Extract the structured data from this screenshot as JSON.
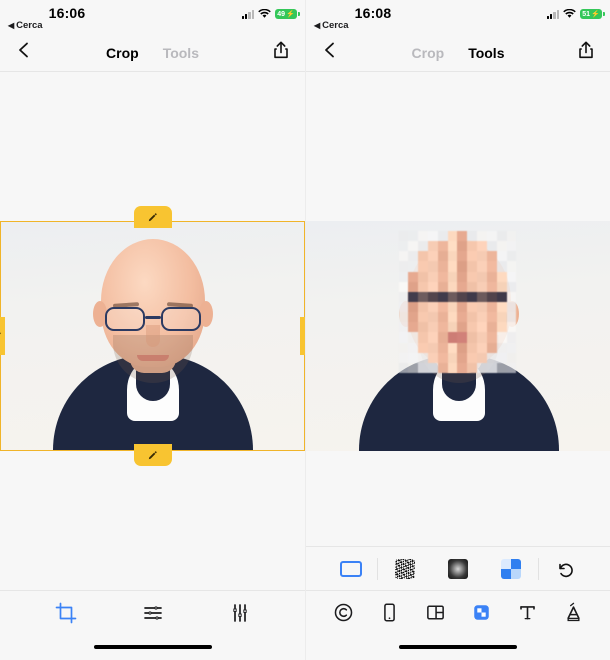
{
  "panels": [
    {
      "id": "crop-screen",
      "status": {
        "time": "16:06",
        "back_app": "Cerca",
        "back_arrow": "◀",
        "battery_percent": "49",
        "battery_bolt": "⚡",
        "signal_icon": "cellular-signal-icon",
        "wifi_icon": "wifi-icon"
      },
      "nav": {
        "back_icon": "chevron-left-icon",
        "share_icon": "share-icon",
        "tabs": [
          {
            "label": "Crop",
            "active": true
          },
          {
            "label": "Tools",
            "active": false
          }
        ]
      },
      "crop": {
        "handle_icon": "pencil-icon",
        "frame_color": "#f0b429",
        "handle_color": "#f8c431",
        "handles": [
          "top",
          "right",
          "bottom",
          "left"
        ]
      },
      "toolbar": [
        {
          "name": "crop-tool",
          "icon": "crop-icon",
          "active": true
        },
        {
          "name": "adjust-tool",
          "icon": "sliders-horizontal-icon",
          "active": false
        },
        {
          "name": "markup-tool",
          "icon": "sliders-vertical-icon",
          "active": false
        }
      ]
    },
    {
      "id": "tools-screen",
      "status": {
        "time": "16:08",
        "back_app": "Cerca",
        "back_arrow": "◀",
        "battery_percent": "51",
        "battery_bolt": "⚡",
        "signal_icon": "cellular-signal-icon",
        "wifi_icon": "wifi-icon"
      },
      "nav": {
        "back_icon": "chevron-left-icon",
        "share_icon": "share-icon",
        "tabs": [
          {
            "label": "Crop",
            "active": false
          },
          {
            "label": "Tools",
            "active": true
          }
        ]
      },
      "blurbar": [
        {
          "name": "rectangle-select-tool",
          "icon": "rectangle-icon",
          "active": true
        },
        {
          "name": "noise-blur-style",
          "icon": "noise-swatch-icon",
          "active": false
        },
        {
          "name": "gaussian-blur-style",
          "icon": "gaussian-swatch-icon",
          "active": false
        },
        {
          "name": "pixelate-blur-style",
          "icon": "pixelate-swatch-icon",
          "active": true
        },
        {
          "name": "undo-button",
          "icon": "undo-icon",
          "active": false
        }
      ],
      "toolbar": [
        {
          "name": "watermark-tool",
          "icon": "copyright-icon",
          "active": false
        },
        {
          "name": "device-frame-tool",
          "icon": "phone-icon",
          "active": false
        },
        {
          "name": "layout-tool",
          "icon": "layout-grid-icon",
          "active": false
        },
        {
          "name": "pixelate-tool",
          "icon": "pixelate-icon",
          "active": true
        },
        {
          "name": "text-tool",
          "icon": "text-icon",
          "active": false
        },
        {
          "name": "annotate-tool",
          "icon": "highlighter-icon",
          "active": false
        }
      ]
    }
  ],
  "colors": {
    "accent_blue": "#3b82f6",
    "crop_yellow": "#f0b429",
    "handle_yellow": "#f8c431",
    "battery_green": "#34c759",
    "inactive_gray": "#b9b9bd",
    "background": "#f7f7f7"
  }
}
